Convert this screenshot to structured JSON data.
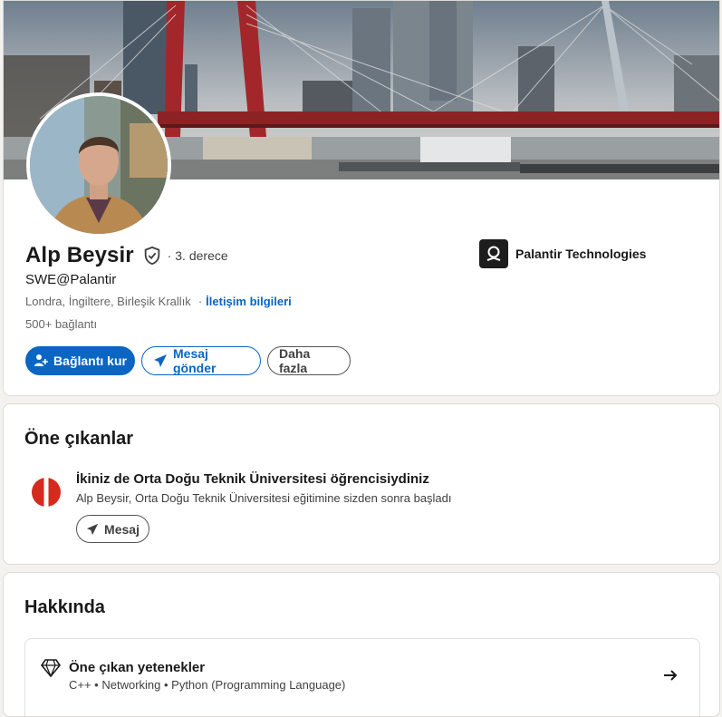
{
  "profile": {
    "name": "Alp Beysir",
    "degree": "· 3. derece",
    "headline": "SWE@Palantir",
    "location": "Londra, İngiltere, Birleşik Krallık",
    "separator": "·",
    "contact_info_label": "İletişim bilgileri",
    "connections": "500+ bağlantı",
    "company": "Palantir Technologies",
    "actions": {
      "connect_label": "Bağlantı kur",
      "message_label": "Mesaj gönder",
      "more_label": "Daha fazla"
    }
  },
  "highlights": {
    "title": "Öne çıkanlar",
    "item_title": "İkiniz de Orta Doğu Teknik Üniversitesi öğrencisiydiniz",
    "item_subtitle": "Alp Beysir, Orta Doğu Teknik Üniversitesi eğitimine sizden sonra başladı",
    "message_label": "Mesaj"
  },
  "about": {
    "title": "Hakkında",
    "skills_title": "Öne çıkan yetenekler",
    "skills_list": "C++ • Networking • Python (Programming Language)"
  },
  "colors": {
    "accent": "#0a66c2",
    "page_bg": "#f4f2ee",
    "university_red": "#d52b1e"
  },
  "icons": {
    "verified": "shield-check-icon",
    "connect": "add-person-icon",
    "message": "paper-plane-icon",
    "skills": "diamond-icon",
    "arrow": "arrow-right-icon"
  }
}
